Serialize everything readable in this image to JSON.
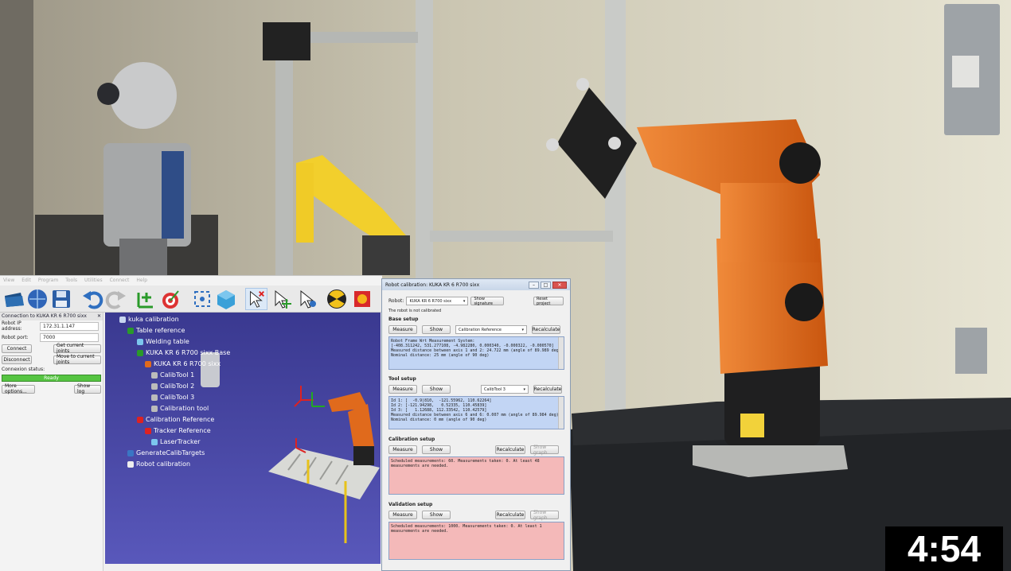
{
  "app": {
    "menu": [
      "View",
      "Edit",
      "Program",
      "Tools",
      "Utilities",
      "Connect",
      "Help"
    ],
    "tree": {
      "root": "kuka calibration",
      "table_reference": "Table reference",
      "welding_table": "Welding table",
      "robot_base": "KUKA KR 6 R700 sixx Base",
      "robot": "KUKA KR 6 R700 sixx",
      "tool1": "CalibTool 1",
      "tool2": "CalibTool 2",
      "tool3": "CalibTool 3",
      "calib_tool": "Calibration tool",
      "calib_reference": "Calibration Reference",
      "tracker_reference": "Tracker Reference",
      "laser_tracker": "LaserTracker",
      "generate": "GenerateCalibTargets",
      "robot_calibration": "Robot calibration"
    }
  },
  "connection": {
    "title": "Connection to KUKA KR 6 R700 sixx",
    "ip_label": "Robot IP address:",
    "ip_value": "172.31.1.147",
    "port_label": "Robot port:",
    "port_value": "7000",
    "connect": "Connect",
    "get_joints": "Get current joints",
    "disconnect": "Disconnect",
    "move_joints": "Move to current joints",
    "status_label": "Connexion status:",
    "status_value": "Ready",
    "more_options": "More options...",
    "show_log": "Show log"
  },
  "dialog": {
    "title": "Robot calibration: KUKA KR 6 R700 sixx",
    "robot_label": "Robot:",
    "robot_value": "KUKA KR 6 R700 sixx",
    "show_signature": "Show signature",
    "reset_project": "Reset project",
    "not_calibrated": "The robot is not calibrated",
    "base_setup": "Base setup",
    "measure": "Measure",
    "show": "Show",
    "calib_reference": "Calibration Reference",
    "recalculate": "Recalculate",
    "base_log": "Robot Frame Wrt Measurement System:\n[-408.311242, 531.277108, -4.982280, 0.000340, -0.000322, -0.000570]\nMeasured distance between axis 1 and 2: 24.722 mm (angle of 89.989 deg)\nNominal distance: 25 mm (angle of 90 deg)",
    "tool_setup": "Tool setup",
    "tool_combo": "CalibTool 3",
    "tool_log": "Id 1: [  -0.9|810,  -121.55962, 110.62264]\nId 2: [-121.94298,   0.52335, 110.45839]\nId 3: [   1.12688, 112.33542, 110.42579]\nMeasured distance between axis 6 and 6: 0.007 mm (angle of 89.984 deg)\nNominal distance: 0 mm (angle of 90 deg)",
    "calib_setup": "Calibration setup",
    "show_graph": "Show graph",
    "calib_log": "Scheduled measurements: 60. Measurements taken: 0. At least 48 measurements are needed.",
    "valid_setup": "Validation setup",
    "valid_log": "Scheduled measurements: 1000. Measurements taken: 0. At least 1 measurements are needed."
  },
  "video": {
    "timer": "4:54"
  },
  "colors": {
    "robot_orange": "#e06a1c",
    "fanuc_yellow": "#f2cf2c",
    "scene_blue": "#4a49a6",
    "status_green": "#56c442"
  }
}
